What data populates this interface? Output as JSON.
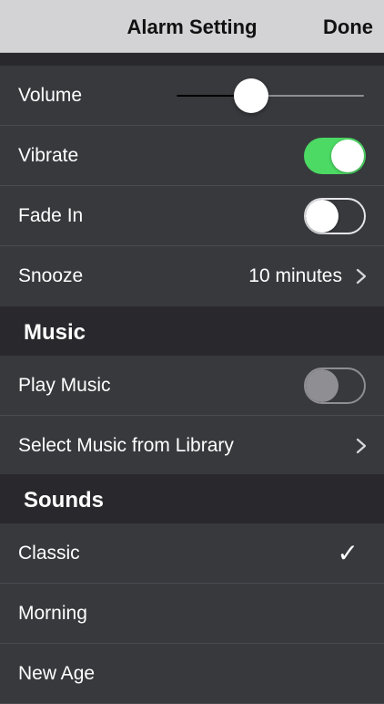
{
  "navbar": {
    "title": "Alarm Setting",
    "done_label": "Done"
  },
  "settings": {
    "volume_label": "Volume",
    "volume_level_percent": 40,
    "vibrate_label": "Vibrate",
    "vibrate_on": true,
    "fade_in_label": "Fade In",
    "fade_in_on": false,
    "snooze_label": "Snooze",
    "snooze_value": "10 minutes"
  },
  "music": {
    "header": "Music",
    "play_music_label": "Play Music",
    "play_music_on": false,
    "select_library_label": "Select Music from Library"
  },
  "sounds": {
    "header": "Sounds",
    "items": [
      {
        "label": "Classic",
        "selected": true
      },
      {
        "label": "Morning",
        "selected": false
      },
      {
        "label": "New Age",
        "selected": false
      }
    ],
    "checkmark": "✓"
  },
  "colors": {
    "switch_on": "#4cd964",
    "background": "#38393d",
    "navbar": "#d3d3d5"
  },
  "icons": {
    "chevron": "chevron-right-icon",
    "check": "checkmark-icon"
  }
}
